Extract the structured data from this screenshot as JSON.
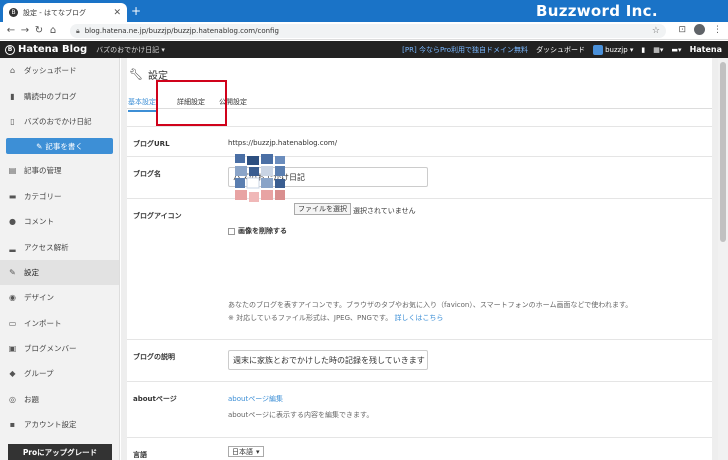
{
  "browser": {
    "tab_title": "設定 - はてなブログ",
    "tab_close": "✕",
    "new_tab": "+",
    "url": "blog.hatena.ne.jp/buzzjp/buzzjp.hatenablog.com/config",
    "brand_overlay": "Buzzword Inc."
  },
  "hatena_bar": {
    "logo": "Hatena Blog",
    "blog_selector": "バズのおでかけ日記 ▾",
    "promo": "[PR] 今ならPro利用で独自ドメイン無料",
    "dashboard": "ダッシュボード",
    "user": "buzzjp ▾",
    "hatena": "Hatena"
  },
  "sidebar": {
    "items_top": [
      {
        "label": "ダッシュボード",
        "icon": "home-icon",
        "glyph": "⌂"
      },
      {
        "label": "購読中のブログ",
        "icon": "bookmark-icon",
        "glyph": "▮"
      },
      {
        "label": "バズのおでかけ日記",
        "icon": "blog-icon",
        "glyph": "▯"
      }
    ],
    "write_button": "記事を書く",
    "items_bottom": [
      {
        "label": "記事の管理",
        "icon": "document-icon",
        "glyph": "▤"
      },
      {
        "label": "カテゴリー",
        "icon": "folder-icon",
        "glyph": "▬"
      },
      {
        "label": "コメント",
        "icon": "comment-icon",
        "glyph": "●"
      },
      {
        "label": "アクセス解析",
        "icon": "chart-icon",
        "glyph": "▂"
      },
      {
        "label": "設定",
        "icon": "wrench-icon",
        "glyph": "✎",
        "active": true
      },
      {
        "label": "デザイン",
        "icon": "palette-icon",
        "glyph": "◉"
      },
      {
        "label": "インポート",
        "icon": "import-icon",
        "glyph": "▭"
      },
      {
        "label": "ブログメンバー",
        "icon": "members-icon",
        "glyph": "▣"
      },
      {
        "label": "グループ",
        "icon": "group-icon",
        "glyph": "◆"
      },
      {
        "label": "お題",
        "icon": "topic-icon",
        "glyph": "◎"
      },
      {
        "label": "アカウント設定",
        "icon": "account-icon",
        "glyph": "▪"
      }
    ],
    "upgrade": "Proにアップグレード"
  },
  "main": {
    "title": "設定",
    "tabs": [
      "基本設定",
      "詳細設定",
      "公開設定"
    ],
    "rows": {
      "url_label": "ブログURL",
      "url_value": "https://buzzjp.hatenablog.com/",
      "name_label": "ブログ名",
      "name_value": "バズのおでかけ日記",
      "icon_label": "ブログアイコン",
      "file_button": "ファイルを選択",
      "file_status": "選択されていません",
      "delete_image": "画像を削除する",
      "icon_help": "あなたのブログを表すアイコンです。ブラウザのタブやお気に入り（favicon）、スマートフォンのホーム画面などで使われます。",
      "icon_help2": "※ 対応しているファイル形式は、JPEG、PNGです。",
      "icon_help_link": "詳しくはこちら",
      "desc_label": "ブログの説明",
      "desc_value": "週末に家族とおでかけした時の記録を残していきます",
      "about_label": "aboutページ",
      "about_link": "aboutページ編集",
      "about_help": "aboutページに表示する内容を編集できます。",
      "lang_label": "言語",
      "lang_value": "日本語"
    }
  }
}
